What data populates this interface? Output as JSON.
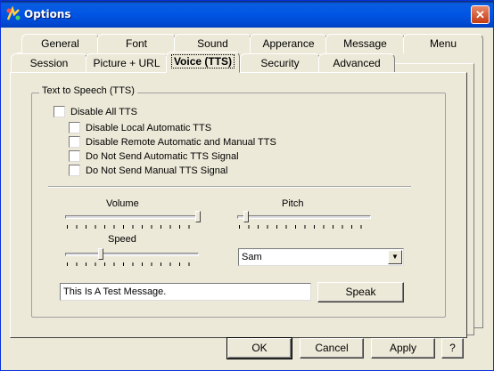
{
  "window": {
    "title": "Options",
    "close_glyph": "✕"
  },
  "tabs": {
    "back_row": [
      {
        "label": "General",
        "accel": "G"
      },
      {
        "label": "Font",
        "accel": "F"
      },
      {
        "label": "Sound",
        "accel": "S"
      },
      {
        "label": "Apperance",
        "accel": "A"
      },
      {
        "label": "Message",
        "accel": "M"
      },
      {
        "label": "Menu",
        "accel": ""
      }
    ],
    "front_row": [
      {
        "label": "Session",
        "accel": ""
      },
      {
        "label": "Picture + URL",
        "accel": "P"
      },
      {
        "label": "Voice (TTS)",
        "accel": ""
      },
      {
        "label": "Security",
        "accel": "c"
      },
      {
        "label": "Advanced",
        "accel": "d"
      }
    ],
    "active": "Voice (TTS)"
  },
  "tts": {
    "group_label": "Text to Speech (TTS)",
    "disable_all": {
      "label": "Disable All TTS",
      "checked": false
    },
    "options": [
      {
        "label": "Disable Local Automatic TTS",
        "checked": false
      },
      {
        "label": "Disable Remote Automatic and Manual TTS",
        "checked": false
      },
      {
        "label": "Do Not Send Automatic TTS Signal",
        "checked": false
      },
      {
        "label": "Do Not Send Manual TTS Signal",
        "checked": false
      }
    ],
    "volume": {
      "label": "Volume",
      "level": 1.0
    },
    "pitch": {
      "label": "Pitch",
      "level": 0.05
    },
    "speed": {
      "label": "Speed",
      "level": 0.25
    },
    "voice": {
      "selected": "Sam",
      "arrow_glyph": "▼"
    },
    "test_message": "This Is A Test Message.",
    "speak_button": "Speak"
  },
  "buttons": {
    "ok": "OK",
    "cancel": "Cancel",
    "apply": "Apply",
    "help": "?"
  }
}
